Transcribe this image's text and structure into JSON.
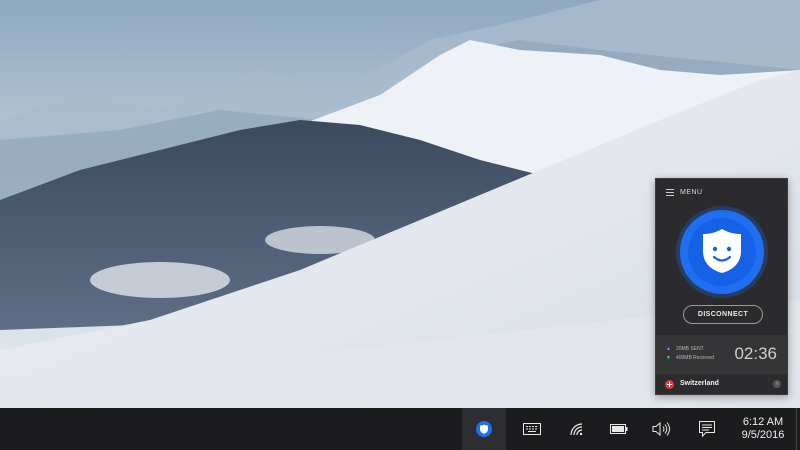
{
  "vpn": {
    "menu_label": "MENU",
    "disconnect_label": "DISCONNECT",
    "sent_label": "20MB SENT",
    "received_label": "400MB Recieved",
    "timer": "02:36",
    "location": "Switzerland",
    "info_label": "i",
    "accent_color": "#1f6ff0"
  },
  "taskbar": {
    "time": "6:12 AM",
    "date": "9/5/2016",
    "icons": [
      "vpn-shield-icon",
      "keyboard-icon",
      "wifi-icon",
      "battery-icon",
      "volume-icon",
      "notifications-icon"
    ]
  }
}
